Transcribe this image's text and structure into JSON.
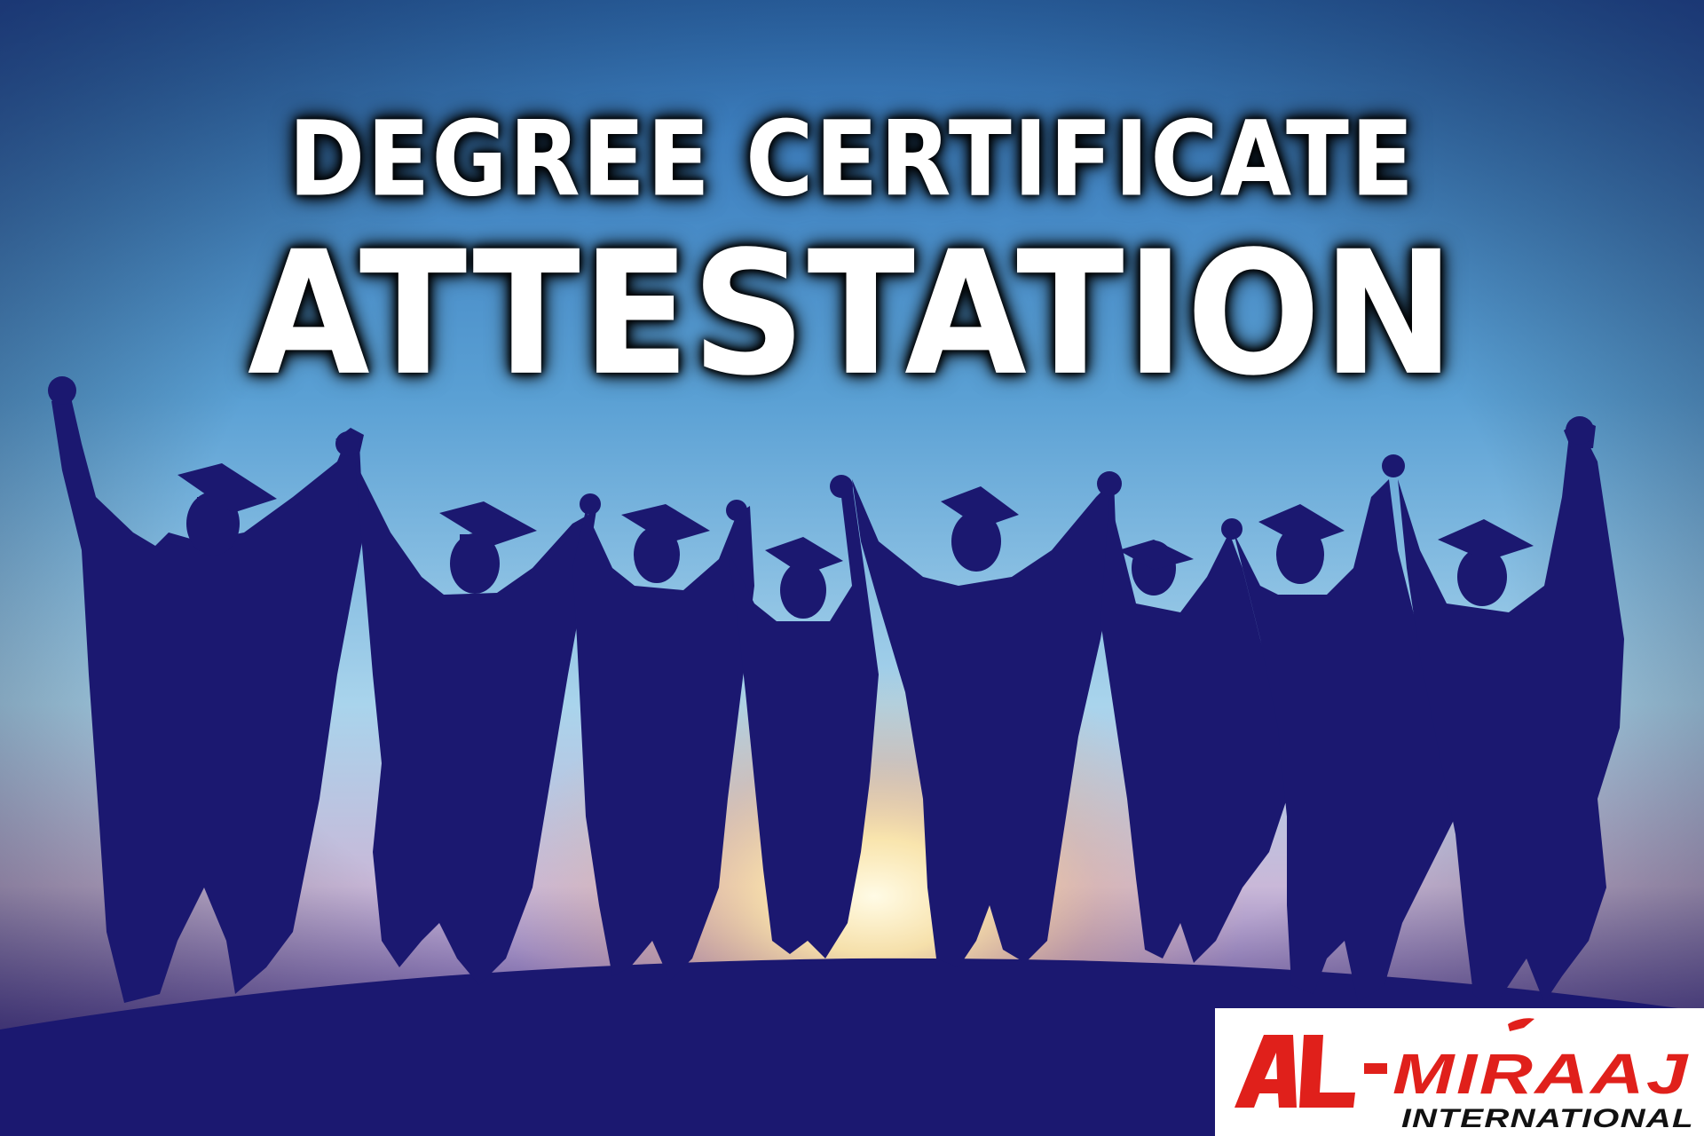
{
  "headline": {
    "line1": "DEGREE CERTIFICATE",
    "line2": "ATTESTATION"
  },
  "logo": {
    "text_main": "AL-MIRAAJ",
    "text_sub": "INTERNATIONAL",
    "main_color": "#e0201b",
    "sub_color": "#111111"
  },
  "colors": {
    "sky_top": "#4a8fcc",
    "sky_mid": "#8ec2e4",
    "horizon_glow": "#ffe9a8",
    "silhouette": "#1b1870"
  },
  "scene": {
    "subject": "silhouette-graduates-group",
    "graduate_count": 8
  }
}
